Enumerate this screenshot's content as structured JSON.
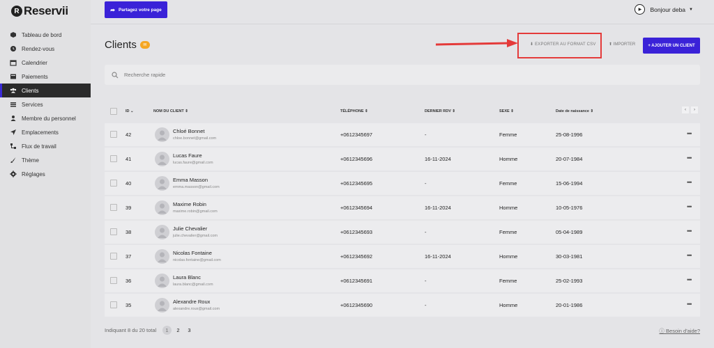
{
  "brand": {
    "logo_letter": "R",
    "name": "Reservii"
  },
  "sidebar": {
    "items": [
      {
        "label": "Tableau de bord",
        "icon": "dashboard-icon"
      },
      {
        "label": "Rendez-vous",
        "icon": "clock-icon"
      },
      {
        "label": "Calendrier",
        "icon": "calendar-icon"
      },
      {
        "label": "Paiements",
        "icon": "payments-icon"
      },
      {
        "label": "Clients",
        "icon": "users-icon",
        "active": true
      },
      {
        "label": "Services",
        "icon": "services-icon"
      },
      {
        "label": "Membre du personnel",
        "icon": "person-icon"
      },
      {
        "label": "Emplacements",
        "icon": "location-arrow-icon"
      },
      {
        "label": "Flux de travail",
        "icon": "workflow-icon"
      },
      {
        "label": "Thème",
        "icon": "brush-icon"
      },
      {
        "label": "Réglages",
        "icon": "gear-icon"
      }
    ]
  },
  "topbar": {
    "share_label": "Partagez votre page",
    "user_label": "Bonjour deba"
  },
  "page": {
    "title": "Clients",
    "export_label": "EXPORTER AU FORMAT CSV",
    "import_label": "IMPORTER",
    "add_label": "+ AJOUTER UN CLIENT"
  },
  "search": {
    "placeholder": "Recherche rapide"
  },
  "table": {
    "headers": {
      "id": "ID",
      "name": "NOM DU CLIENT",
      "phone": "TÉLÉPHONE",
      "last": "DERNIER RDV",
      "sex": "SEXE",
      "birth": "Date de naissance"
    },
    "rows": [
      {
        "id": "42",
        "name": "Chloé Bonnet",
        "email": "chloe.bonnet@gmail.com",
        "phone": "+0612345697",
        "last": "-",
        "sex": "Femme",
        "birth": "25-08-1996"
      },
      {
        "id": "41",
        "name": "Lucas Faure",
        "email": "lucas.faure@gmail.com",
        "phone": "+0612345696",
        "last": "16-11-2024",
        "sex": "Homme",
        "birth": "20-07-1984"
      },
      {
        "id": "40",
        "name": "Emma Masson",
        "email": "emma.masson@gmail.com",
        "phone": "+0612345695",
        "last": "-",
        "sex": "Femme",
        "birth": "15-06-1994"
      },
      {
        "id": "39",
        "name": "Maxime Robin",
        "email": "maxime.robin@gmail.com",
        "phone": "+0612345694",
        "last": "16-11-2024",
        "sex": "Homme",
        "birth": "10-05-1976"
      },
      {
        "id": "38",
        "name": "Julie Chevalier",
        "email": "julie.chevalier@gmail.com",
        "phone": "+0612345693",
        "last": "-",
        "sex": "Femme",
        "birth": "05-04-1989"
      },
      {
        "id": "37",
        "name": "Nicolas Fontaine",
        "email": "nicolas.fontaine@gmail.com",
        "phone": "+0612345692",
        "last": "16-11-2024",
        "sex": "Homme",
        "birth": "30-03-1981"
      },
      {
        "id": "36",
        "name": "Laura Blanc",
        "email": "laura.blanc@gmail.com",
        "phone": "+0612345691",
        "last": "-",
        "sex": "Femme",
        "birth": "25-02-1993"
      },
      {
        "id": "35",
        "name": "Alexandre Roux",
        "email": "alexandre.roux@gmail.com",
        "phone": "+0612345690",
        "last": "-",
        "sex": "Homme",
        "birth": "20-01-1986"
      }
    ]
  },
  "footer": {
    "info": "Indiquant 8 du 20 total",
    "pages": [
      "1",
      "2",
      "3"
    ],
    "current_page": "1",
    "help_label": "Besoin d'aide?"
  },
  "colors": {
    "accent": "#3a22d8",
    "highlight": "#e43a3a",
    "badge": "#f5a623"
  }
}
